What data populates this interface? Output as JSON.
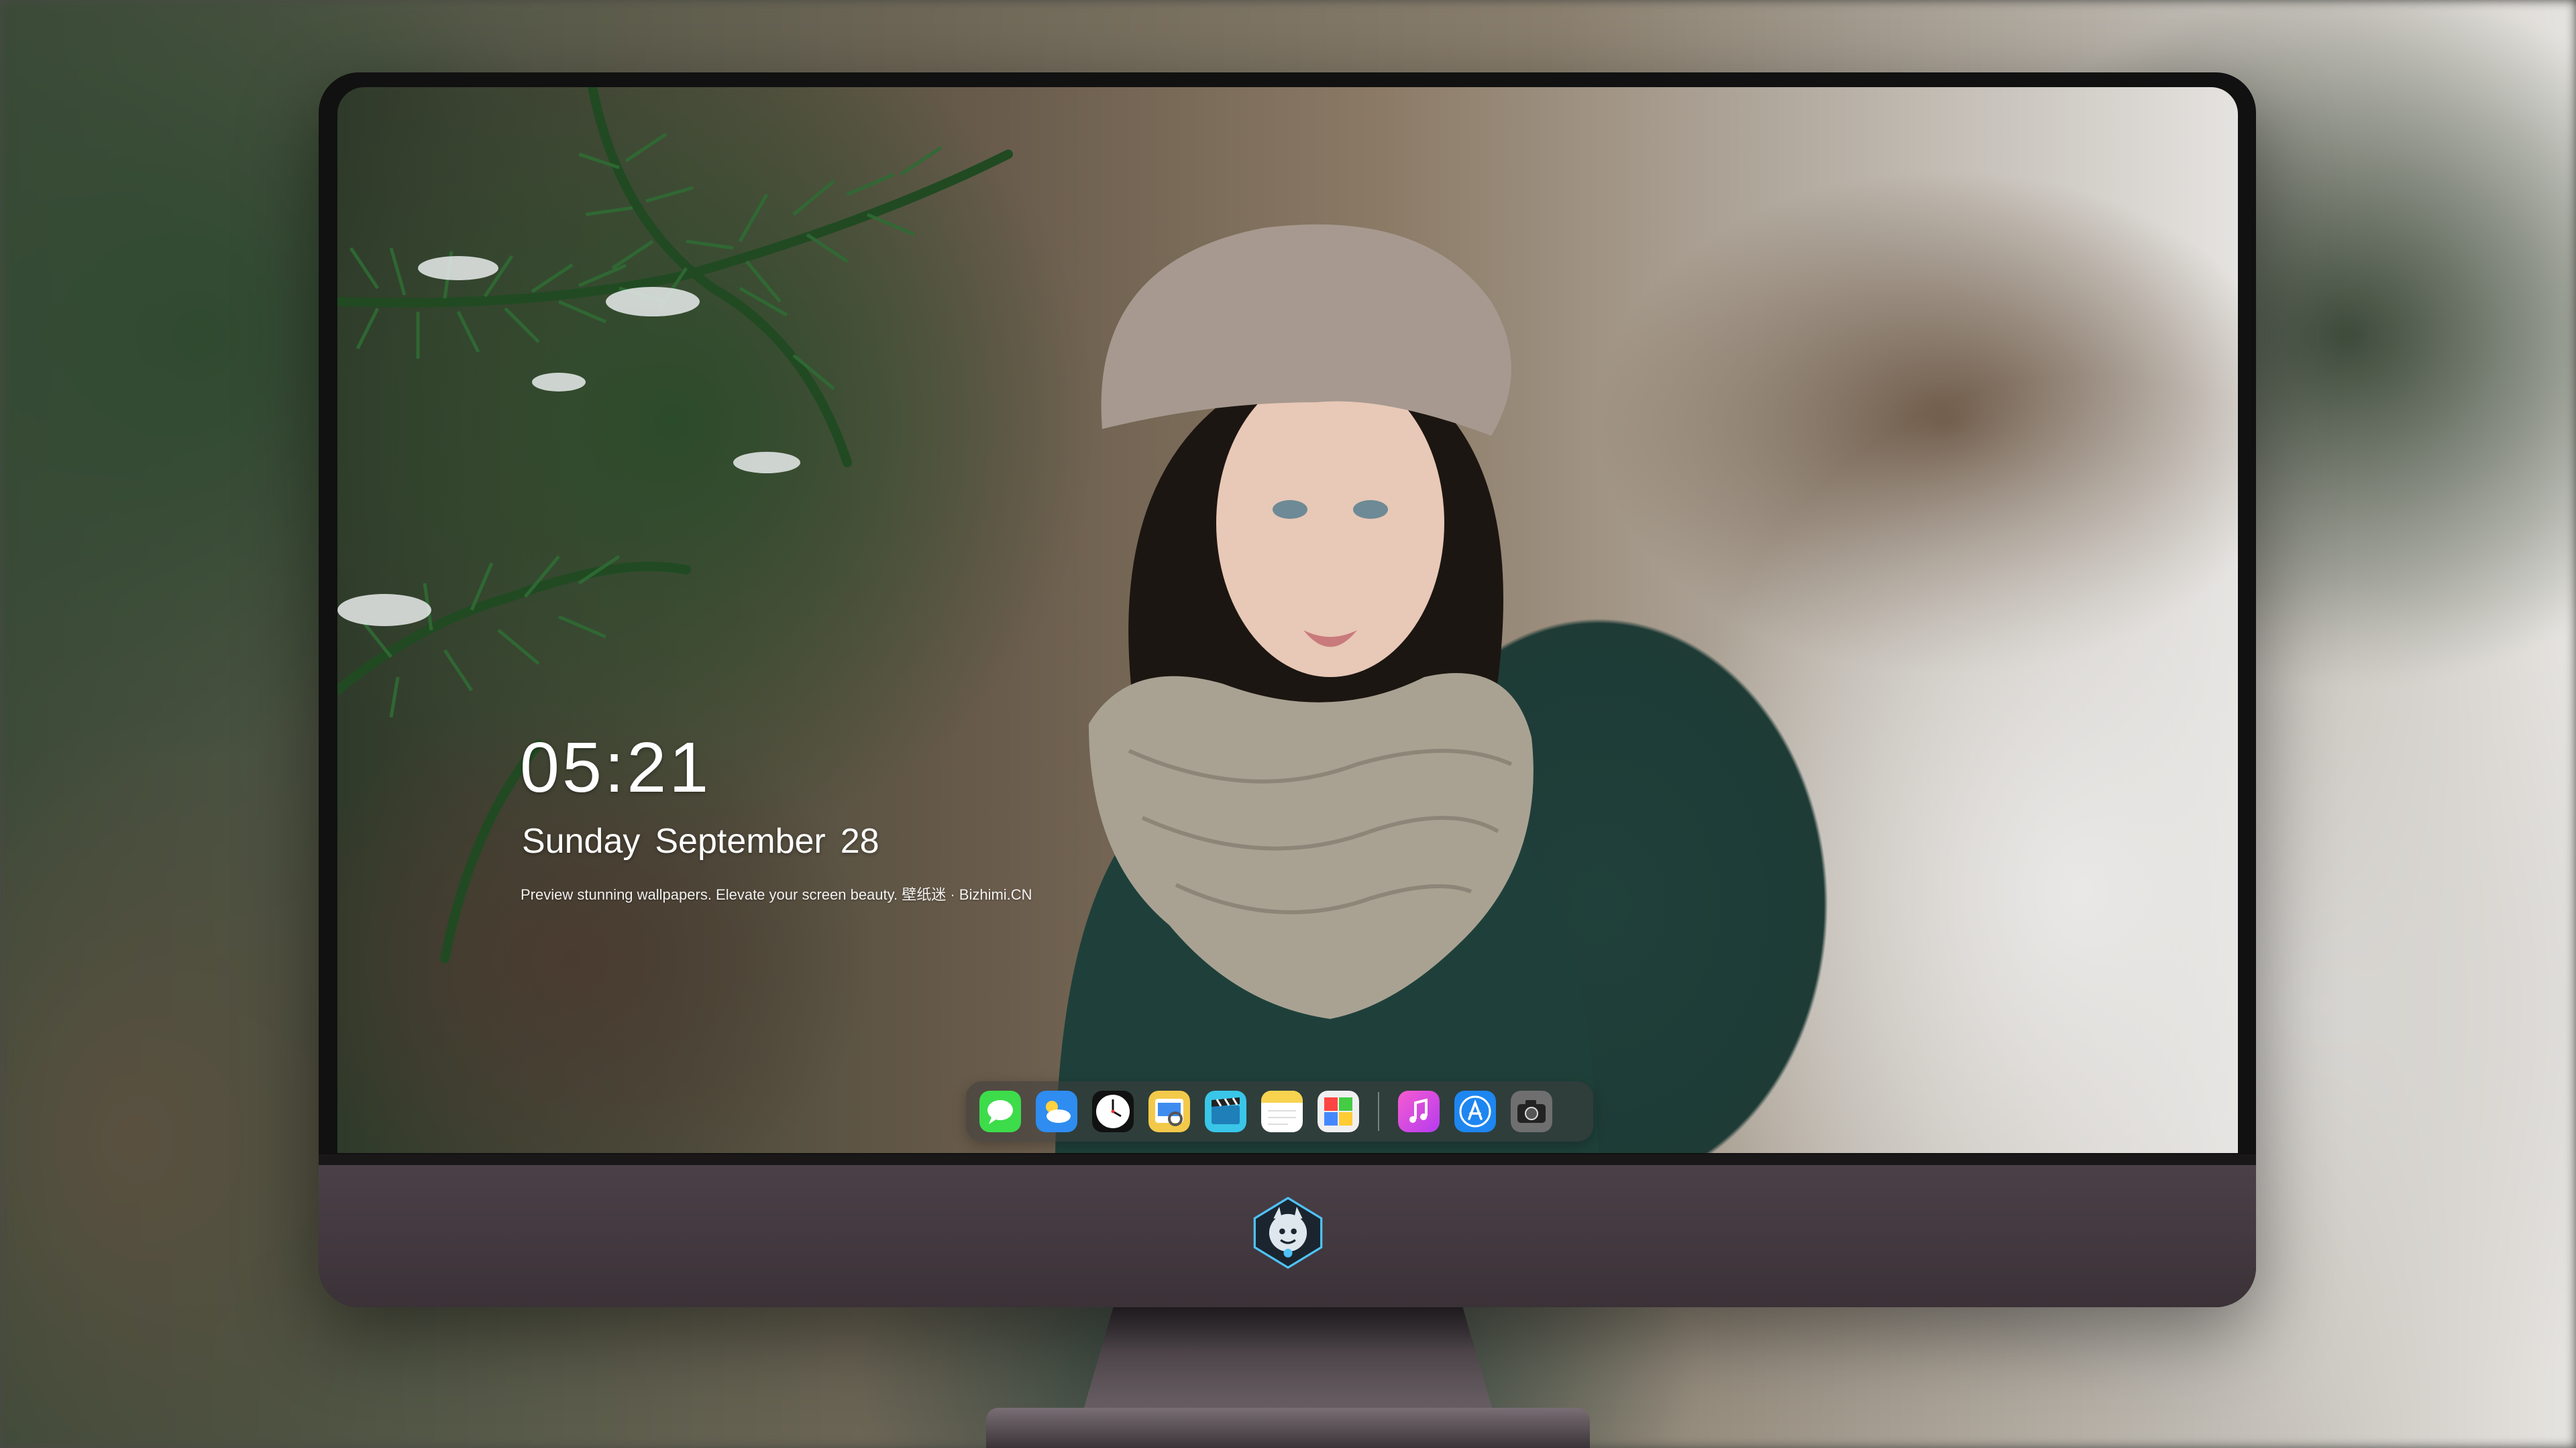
{
  "lock_screen": {
    "time": "05:21",
    "date": {
      "weekday": "Sunday",
      "month": "September",
      "day": "28"
    },
    "tagline": "Preview stunning wallpapers. Elevate your screen beauty. 壁纸迷 · Bizhimi.CN"
  },
  "dock": {
    "apps": [
      {
        "icon": "messages-icon",
        "color": "#3ddc4a"
      },
      {
        "icon": "weather-icon",
        "color": "#2f8cf0"
      },
      {
        "icon": "clock-icon",
        "color": "#111111"
      },
      {
        "icon": "preview-icon",
        "color": "#f3c94a"
      },
      {
        "icon": "clips-icon",
        "color": "#39c6e8"
      },
      {
        "icon": "notes-icon",
        "color": "#f7d34f"
      },
      {
        "icon": "photos-icon",
        "color": "#f0f0f0"
      },
      {
        "icon": "music-icon",
        "color": "#e14fd1"
      },
      {
        "icon": "app-store-icon",
        "color": "#1e86f0"
      },
      {
        "icon": "camera-icon",
        "color": "#6f6f6f"
      }
    ]
  },
  "monitor": {
    "logo": "dragon-mascot-icon",
    "bezel_color": "#111111",
    "chin_color": "#4b4047"
  }
}
